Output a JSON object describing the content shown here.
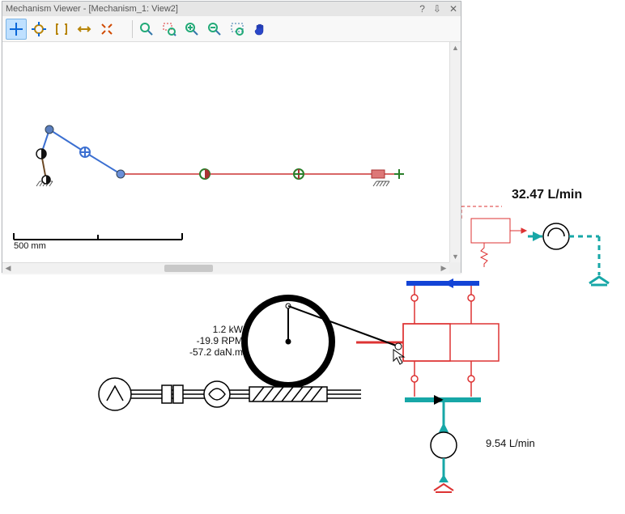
{
  "window": {
    "title": "Mechanism Viewer - [Mechanism_1: View2]",
    "help": "?",
    "pin": "⇩",
    "close": "✕"
  },
  "ruler": {
    "label": "500 mm"
  },
  "readings": {
    "power": "1.2 kW",
    "speed": "-19.9 RPM",
    "torque": "-57.2 daN.m",
    "flow_top": "32.47 L/min",
    "flow_bottom": "9.54 L/min"
  },
  "toolbar": {
    "group_view": [
      "move-cross-icon",
      "target-icon",
      "bracket-icon",
      "widen-icon",
      "expand-icon"
    ],
    "group_zoom": [
      "zoom-icon",
      "zoom-region-icon",
      "zoom-in-icon",
      "zoom-out-icon",
      "pan-select-icon",
      "hand-icon"
    ],
    "selected_index": 0
  }
}
